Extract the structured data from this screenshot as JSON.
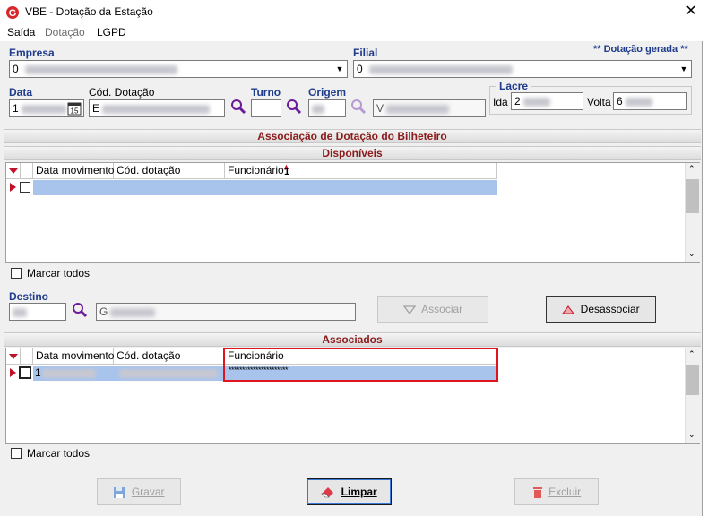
{
  "window": {
    "title": "VBE - Dotação da Estação",
    "close_symbol": "✕"
  },
  "menu": [
    {
      "label": "Saída"
    },
    {
      "label": "Dotação"
    },
    {
      "label": "LGPD"
    }
  ],
  "form": {
    "empresa_label": "Empresa",
    "empresa_value": "0",
    "filial_label": "Filial",
    "filial_value": "0",
    "dotacao_gerada": "** Dotação gerada **",
    "data_label": "Data",
    "data_value": "1",
    "cod_dotacao_label": "Cód. Dotação",
    "cod_dotacao_value": "E",
    "turno_label": "Turno",
    "origem_label": "Origem",
    "origem_desc_value": "V",
    "lacre_label": "Lacre",
    "ida_label": "Ida",
    "ida_value": "2",
    "volta_label": "Volta",
    "volta_value": "6"
  },
  "main_title": "Associação de Dotação do Bilheteiro",
  "disponiveis": {
    "title": "Disponíveis",
    "columns": [
      "Data movimento",
      "Cód. dotação",
      "Funcionário"
    ],
    "sort_badge": "1",
    "marcar_todos": "Marcar todos"
  },
  "destino": {
    "label": "Destino",
    "desc_value": "G"
  },
  "buttons": {
    "associar": "Associar",
    "desassociar": "Desassociar",
    "gravar": "Gravar",
    "limpar": "Limpar",
    "excluir": "Excluir"
  },
  "associados": {
    "title": "Associados",
    "columns": [
      "Data movimento",
      "Cód. dotação",
      "Funcionário"
    ],
    "rows": [
      {
        "data": "1",
        "cod": "",
        "funcionario": "**********************"
      }
    ],
    "marcar_todos": "Marcar todos"
  },
  "colors": {
    "section_title": "#8b1a1a",
    "label_blue": "#1f3b8c",
    "selection": "#a8c4ec",
    "highlight": "#e0141e"
  }
}
